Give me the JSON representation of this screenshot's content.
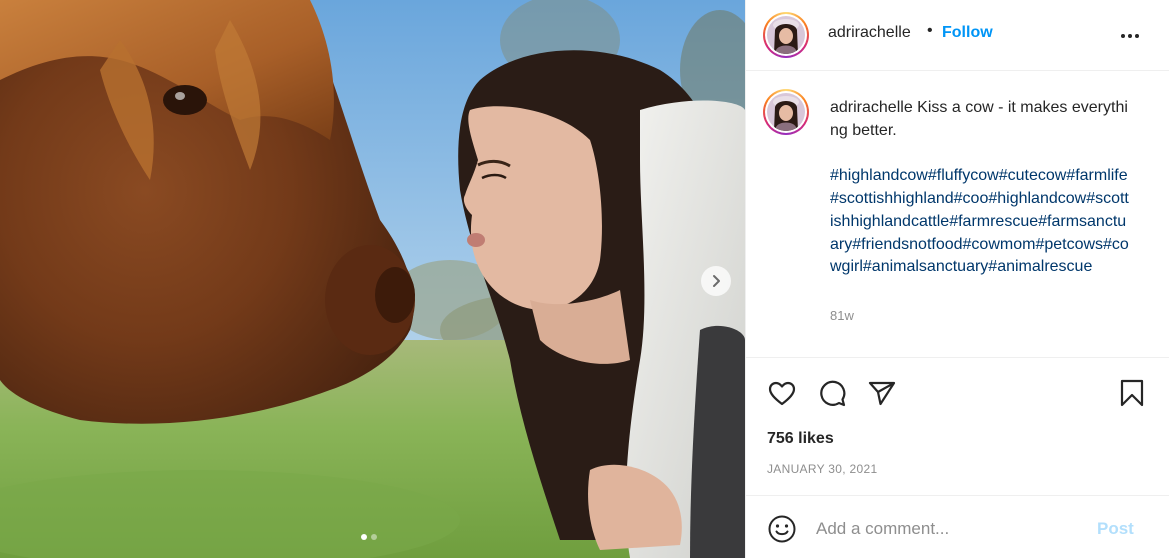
{
  "media": {
    "image_description_icon": "photo-cow-and-woman",
    "next_icon": "chevron-right-icon",
    "carousel": {
      "total": 2,
      "active_index": 0
    }
  },
  "header": {
    "username": "adrirachelle",
    "separator": "•",
    "follow_label": "Follow",
    "more_icon": "more-horizontal-icon"
  },
  "caption": {
    "username": "adrirachelle",
    "text": "Kiss a cow - it makes everything better.",
    "hashtags": "#highlandcow#fluffycow#cutecow#farmlife#scottishhighland#coo#highlandcow#scottishhighlandcattle#farmrescue#farmsanctuary#friendsnotfood#cowmom#petcows#cowgirl#animalsanctuary#animalrescue",
    "age": "81w"
  },
  "actions": {
    "like_icon": "heart-icon",
    "comment_icon": "comment-icon",
    "share_icon": "paper-plane-icon",
    "save_icon": "bookmark-icon",
    "likes": "756 likes",
    "date": "JANUARY 30, 2021"
  },
  "comment": {
    "emoji_icon": "emoji-icon",
    "placeholder": "Add a comment...",
    "value": "",
    "post_label": "Post"
  },
  "colors": {
    "link_blue": "#0095f6",
    "hashtag_blue": "#00376b",
    "muted_gray": "#8e8e8e",
    "post_disabled": "#b2dffc"
  }
}
